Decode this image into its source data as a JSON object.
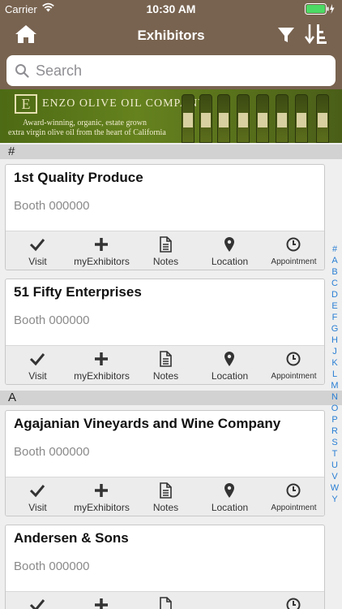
{
  "status_bar": {
    "carrier": "Carrier",
    "time": "10:30 AM"
  },
  "nav": {
    "title": "Exhibitors"
  },
  "search": {
    "placeholder": "Search"
  },
  "banner": {
    "logo_letter": "E",
    "company": "ENZO OLIVE OIL COMPANY",
    "tagline_1": "Award-winning, organic, estate grown",
    "tagline_2": "extra virgin olive oil from the heart of California"
  },
  "sections": [
    {
      "header": "#"
    },
    {
      "header": "A"
    }
  ],
  "action_labels": {
    "visit": "Visit",
    "my_exhibitors": "myExhibitors",
    "notes": "Notes",
    "location": "Location",
    "appointment": "Appointment"
  },
  "exhibitors": [
    {
      "name": "1st Quality Produce",
      "booth": "Booth 000000"
    },
    {
      "name": "51 Fifty Enterprises",
      "booth": "Booth 000000"
    },
    {
      "name": "Agajanian Vineyards and Wine Company",
      "booth": "Booth 000000"
    },
    {
      "name": "Andersen & Sons",
      "booth": "Booth 000000"
    }
  ],
  "index_letters": [
    "#",
    "A",
    "B",
    "C",
    "D",
    "E",
    "F",
    "G",
    "H",
    "J",
    "K",
    "L",
    "M",
    "N",
    "O",
    "P",
    "R",
    "S",
    "T",
    "U",
    "V",
    "W",
    "Y"
  ],
  "colors": {
    "nav_bg": "#786350",
    "index_link": "#2a7fd4",
    "battery": "#4cd964"
  }
}
